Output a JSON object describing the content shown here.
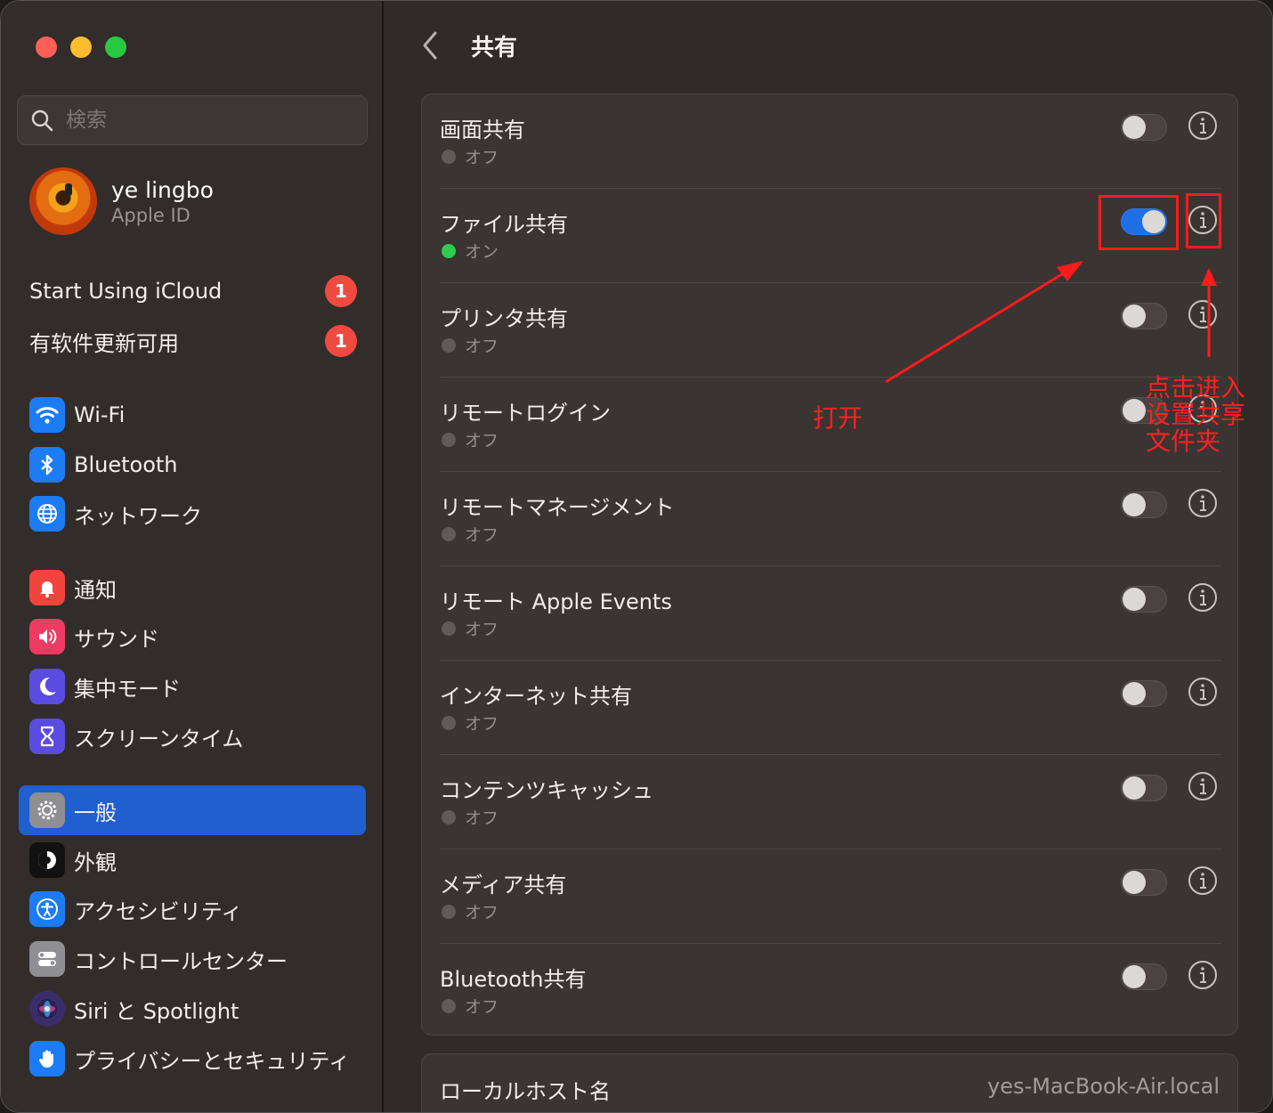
{
  "window": {
    "title": "共有"
  },
  "sidebar": {
    "search_placeholder": "検索",
    "account": {
      "name": "ye lingbo",
      "sub": "Apple ID"
    },
    "notices": [
      {
        "label": "Start Using iCloud",
        "badge": "1"
      },
      {
        "label": "有软件更新可用",
        "badge": "1"
      }
    ],
    "items": [
      {
        "label": "Wi-Fi",
        "icon": "wifi-icon",
        "color": "#1b7cf5"
      },
      {
        "label": "Bluetooth",
        "icon": "bluetooth-icon",
        "color": "#1b7cf5"
      },
      {
        "label": "ネットワーク",
        "icon": "globe-icon",
        "color": "#1b7cf5"
      },
      {
        "label": "通知",
        "icon": "bell-icon",
        "color": "#f0453c"
      },
      {
        "label": "サウンド",
        "icon": "speaker-icon",
        "color": "#ee3b62"
      },
      {
        "label": "集中モード",
        "icon": "moon-icon",
        "color": "#5b4ce0"
      },
      {
        "label": "スクリーンタイム",
        "icon": "hourglass-icon",
        "color": "#5b4ce0"
      },
      {
        "label": "一般",
        "icon": "gear-icon",
        "color": "#8e8e93",
        "selected": true
      },
      {
        "label": "外観",
        "icon": "appearance-icon",
        "color": "#111111"
      },
      {
        "label": "アクセシビリティ",
        "icon": "accessibility-icon",
        "color": "#1b7cf5"
      },
      {
        "label": "コントロールセンター",
        "icon": "control-center-icon",
        "color": "#8e8e93"
      },
      {
        "label": "Siri と Spotlight",
        "icon": "siri-icon",
        "color": "#3a2e6a"
      },
      {
        "label": "プライバシーとセキュリティ",
        "icon": "hand-icon",
        "color": "#1b7cf5"
      }
    ]
  },
  "main": {
    "title": "共有",
    "rows": [
      {
        "title": "画面共有",
        "status": "オフ",
        "on": false
      },
      {
        "title": "ファイル共有",
        "status": "オン",
        "on": true
      },
      {
        "title": "プリンタ共有",
        "status": "オフ",
        "on": false
      },
      {
        "title": "リモートログイン",
        "status": "オフ",
        "on": false
      },
      {
        "title": "リモートマネージメント",
        "status": "オフ",
        "on": false
      },
      {
        "title": "リモート Apple Events",
        "status": "オフ",
        "on": false
      },
      {
        "title": "インターネット共有",
        "status": "オフ",
        "on": false
      },
      {
        "title": "コンテンツキャッシュ",
        "status": "オフ",
        "on": false
      },
      {
        "title": "メディア共有",
        "status": "オフ",
        "on": false
      },
      {
        "title": "Bluetooth共有",
        "status": "オフ",
        "on": false
      }
    ],
    "hostname": {
      "label": "ローカルホスト名",
      "value": "yes-MacBook-Air.local"
    }
  },
  "annotations": {
    "open_label": "打开",
    "info_label_lines": [
      "点击进入",
      "设置共享",
      "文件夹"
    ],
    "color": "#ff1b1b"
  }
}
